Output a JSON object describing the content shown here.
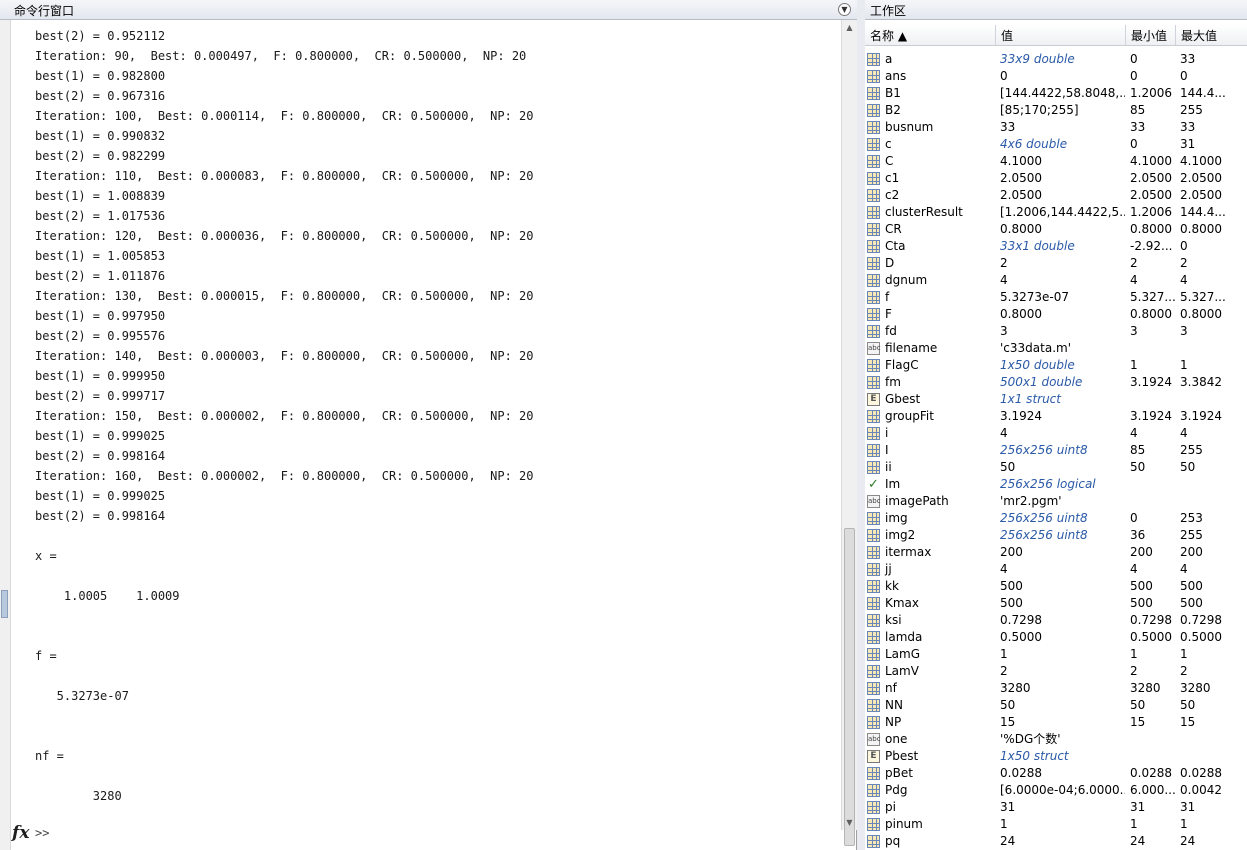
{
  "command_window": {
    "title": "命令行窗口",
    "lines": [
      "best(2) = 0.952112",
      "Iteration: 90,  Best: 0.000497,  F: 0.800000,  CR: 0.500000,  NP: 20",
      "best(1) = 0.982800",
      "best(2) = 0.967316",
      "Iteration: 100,  Best: 0.000114,  F: 0.800000,  CR: 0.500000,  NP: 20",
      "best(1) = 0.990832",
      "best(2) = 0.982299",
      "Iteration: 110,  Best: 0.000083,  F: 0.800000,  CR: 0.500000,  NP: 20",
      "best(1) = 1.008839",
      "best(2) = 1.017536",
      "Iteration: 120,  Best: 0.000036,  F: 0.800000,  CR: 0.500000,  NP: 20",
      "best(1) = 1.005853",
      "best(2) = 1.011876",
      "Iteration: 130,  Best: 0.000015,  F: 0.800000,  CR: 0.500000,  NP: 20",
      "best(1) = 0.997950",
      "best(2) = 0.995576",
      "Iteration: 140,  Best: 0.000003,  F: 0.800000,  CR: 0.500000,  NP: 20",
      "best(1) = 0.999950",
      "best(2) = 0.999717",
      "Iteration: 150,  Best: 0.000002,  F: 0.800000,  CR: 0.500000,  NP: 20",
      "best(1) = 0.999025",
      "best(2) = 0.998164",
      "Iteration: 160,  Best: 0.000002,  F: 0.800000,  CR: 0.500000,  NP: 20",
      "best(1) = 0.999025",
      "best(2) = 0.998164",
      "",
      "x =",
      "",
      "    1.0005    1.0009",
      "",
      "",
      "f =",
      "",
      "   5.3273e-07",
      "",
      "",
      "nf =",
      "",
      "        3280"
    ],
    "prompt": ">>",
    "fx_icon": "fx-icon"
  },
  "workspace": {
    "title": "工作区",
    "columns": {
      "name": "名称 ▲",
      "value": "值",
      "min": "最小值",
      "max": "最大值"
    },
    "variables": [
      {
        "icon": "matrix",
        "name": "a",
        "value": "33x9 double",
        "link": true,
        "min": "0",
        "max": "33"
      },
      {
        "icon": "matrix",
        "name": "ans",
        "value": "0",
        "link": false,
        "min": "0",
        "max": "0"
      },
      {
        "icon": "matrix",
        "name": "B1",
        "value": "[144.4422,58.8048,...",
        "link": false,
        "min": "1.2006",
        "max": "144.4..."
      },
      {
        "icon": "matrix",
        "name": "B2",
        "value": "[85;170;255]",
        "link": false,
        "min": "85",
        "max": "255"
      },
      {
        "icon": "matrix",
        "name": "busnum",
        "value": "33",
        "link": false,
        "min": "33",
        "max": "33"
      },
      {
        "icon": "matrix",
        "name": "c",
        "value": "4x6 double",
        "link": true,
        "min": "0",
        "max": "31"
      },
      {
        "icon": "matrix",
        "name": "C",
        "value": "4.1000",
        "link": false,
        "min": "4.1000",
        "max": "4.1000"
      },
      {
        "icon": "matrix",
        "name": "c1",
        "value": "2.0500",
        "link": false,
        "min": "2.0500",
        "max": "2.0500"
      },
      {
        "icon": "matrix",
        "name": "c2",
        "value": "2.0500",
        "link": false,
        "min": "2.0500",
        "max": "2.0500"
      },
      {
        "icon": "matrix",
        "name": "clusterResult",
        "value": "[1.2006,144.4422,5...",
        "link": false,
        "min": "1.2006",
        "max": "144.4..."
      },
      {
        "icon": "matrix",
        "name": "CR",
        "value": "0.8000",
        "link": false,
        "min": "0.8000",
        "max": "0.8000"
      },
      {
        "icon": "matrix",
        "name": "Cta",
        "value": "33x1 double",
        "link": true,
        "min": "-2.92...",
        "max": "0"
      },
      {
        "icon": "matrix",
        "name": "D",
        "value": "2",
        "link": false,
        "min": "2",
        "max": "2"
      },
      {
        "icon": "matrix",
        "name": "dgnum",
        "value": "4",
        "link": false,
        "min": "4",
        "max": "4"
      },
      {
        "icon": "matrix",
        "name": "f",
        "value": "5.3273e-07",
        "link": false,
        "min": "5.327...",
        "max": "5.327..."
      },
      {
        "icon": "matrix",
        "name": "F",
        "value": "0.8000",
        "link": false,
        "min": "0.8000",
        "max": "0.8000"
      },
      {
        "icon": "matrix",
        "name": "fd",
        "value": "3",
        "link": false,
        "min": "3",
        "max": "3"
      },
      {
        "icon": "char",
        "name": "filename",
        "value": "'c33data.m'",
        "link": false,
        "min": "",
        "max": ""
      },
      {
        "icon": "matrix",
        "name": "FlagC",
        "value": "1x50 double",
        "link": true,
        "min": "1",
        "max": "1"
      },
      {
        "icon": "matrix",
        "name": "fm",
        "value": "500x1 double",
        "link": true,
        "min": "3.1924",
        "max": "3.3842"
      },
      {
        "icon": "struct",
        "name": "Gbest",
        "value": "1x1 struct",
        "link": true,
        "min": "",
        "max": ""
      },
      {
        "icon": "matrix",
        "name": "groupFit",
        "value": "3.1924",
        "link": false,
        "min": "3.1924",
        "max": "3.1924"
      },
      {
        "icon": "matrix",
        "name": "i",
        "value": "4",
        "link": false,
        "min": "4",
        "max": "4"
      },
      {
        "icon": "matrix",
        "name": "I",
        "value": "256x256 uint8",
        "link": true,
        "min": "85",
        "max": "255"
      },
      {
        "icon": "matrix",
        "name": "ii",
        "value": "50",
        "link": false,
        "min": "50",
        "max": "50"
      },
      {
        "icon": "logical",
        "name": "Im",
        "value": "256x256 logical",
        "link": true,
        "min": "",
        "max": ""
      },
      {
        "icon": "char",
        "name": "imagePath",
        "value": "'mr2.pgm'",
        "link": false,
        "min": "",
        "max": ""
      },
      {
        "icon": "matrix",
        "name": "img",
        "value": "256x256 uint8",
        "link": true,
        "min": "0",
        "max": "253"
      },
      {
        "icon": "matrix",
        "name": "img2",
        "value": "256x256 uint8",
        "link": true,
        "min": "36",
        "max": "255"
      },
      {
        "icon": "matrix",
        "name": "itermax",
        "value": "200",
        "link": false,
        "min": "200",
        "max": "200"
      },
      {
        "icon": "matrix",
        "name": "jj",
        "value": "4",
        "link": false,
        "min": "4",
        "max": "4"
      },
      {
        "icon": "matrix",
        "name": "kk",
        "value": "500",
        "link": false,
        "min": "500",
        "max": "500"
      },
      {
        "icon": "matrix",
        "name": "Kmax",
        "value": "500",
        "link": false,
        "min": "500",
        "max": "500"
      },
      {
        "icon": "matrix",
        "name": "ksi",
        "value": "0.7298",
        "link": false,
        "min": "0.7298",
        "max": "0.7298"
      },
      {
        "icon": "matrix",
        "name": "lamda",
        "value": "0.5000",
        "link": false,
        "min": "0.5000",
        "max": "0.5000"
      },
      {
        "icon": "matrix",
        "name": "LamG",
        "value": "1",
        "link": false,
        "min": "1",
        "max": "1"
      },
      {
        "icon": "matrix",
        "name": "LamV",
        "value": "2",
        "link": false,
        "min": "2",
        "max": "2"
      },
      {
        "icon": "matrix",
        "name": "nf",
        "value": "3280",
        "link": false,
        "min": "3280",
        "max": "3280"
      },
      {
        "icon": "matrix",
        "name": "NN",
        "value": "50",
        "link": false,
        "min": "50",
        "max": "50"
      },
      {
        "icon": "matrix",
        "name": "NP",
        "value": "15",
        "link": false,
        "min": "15",
        "max": "15"
      },
      {
        "icon": "char",
        "name": "one",
        "value": "'%DG个数'",
        "link": false,
        "min": "",
        "max": ""
      },
      {
        "icon": "struct",
        "name": "Pbest",
        "value": "1x50 struct",
        "link": true,
        "min": "",
        "max": ""
      },
      {
        "icon": "matrix",
        "name": "pBet",
        "value": "0.0288",
        "link": false,
        "min": "0.0288",
        "max": "0.0288"
      },
      {
        "icon": "matrix",
        "name": "Pdg",
        "value": "[6.0000e-04;6.0000...",
        "link": false,
        "min": "6.000...",
        "max": "0.0042"
      },
      {
        "icon": "matrix",
        "name": "pi",
        "value": "31",
        "link": false,
        "min": "31",
        "max": "31"
      },
      {
        "icon": "matrix",
        "name": "pinum",
        "value": "1",
        "link": false,
        "min": "1",
        "max": "1"
      },
      {
        "icon": "matrix",
        "name": "pq",
        "value": "24",
        "link": false,
        "min": "24",
        "max": "24"
      }
    ]
  }
}
